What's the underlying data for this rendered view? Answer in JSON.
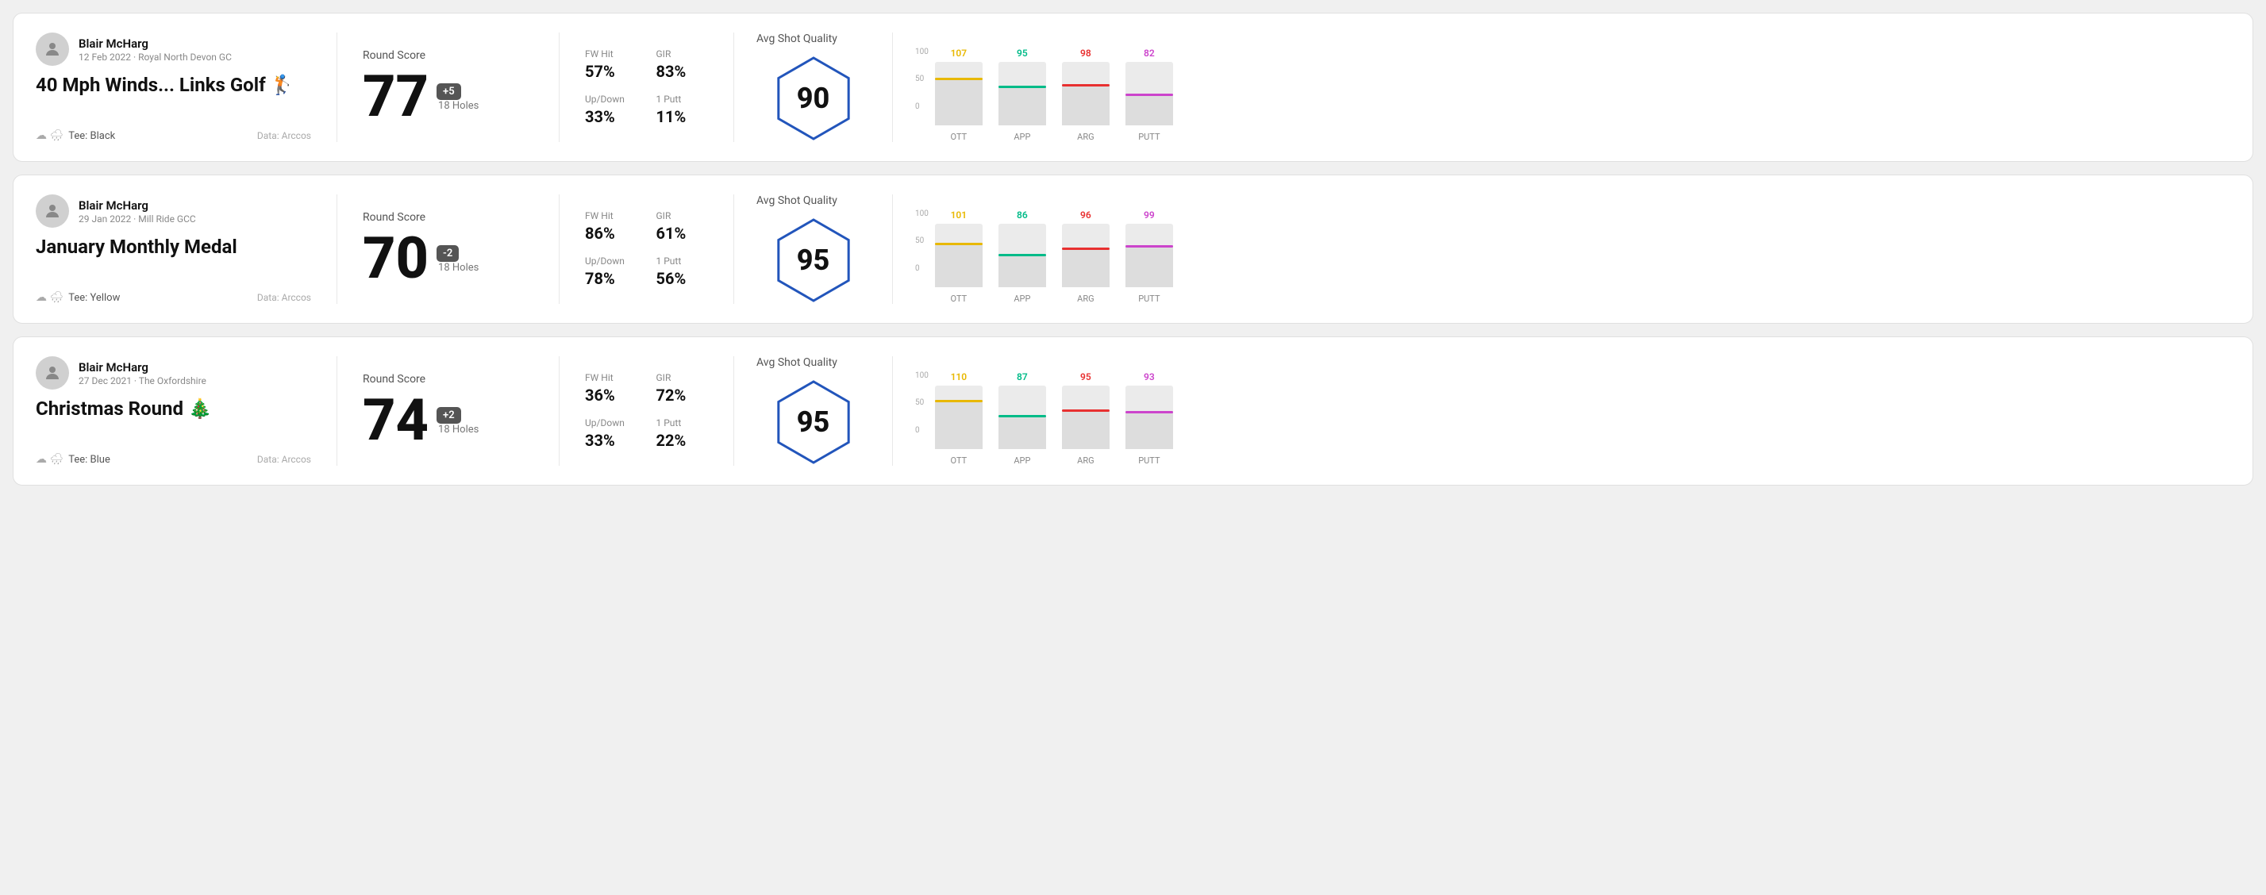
{
  "cards": [
    {
      "id": "card1",
      "player": "Blair McHarg",
      "date": "12 Feb 2022 · Royal North Devon GC",
      "title": "40 Mph Winds... Links Golf 🏌️",
      "tee": "Tee: Black",
      "dataSource": "Data: Arccos",
      "roundScoreLabel": "Round Score",
      "score": "77",
      "scoreBadge": "+5",
      "badgeType": "positive",
      "holes": "18 Holes",
      "stats": [
        {
          "label": "FW Hit",
          "value": "57%"
        },
        {
          "label": "GIR",
          "value": "83%"
        },
        {
          "label": "Up/Down",
          "value": "33%"
        },
        {
          "label": "1 Putt",
          "value": "11%"
        }
      ],
      "qualityLabel": "Avg Shot Quality",
      "qualityScore": "90",
      "bars": [
        {
          "label": "OTT",
          "value": 107,
          "color": "#e8b800",
          "heightPct": 75
        },
        {
          "label": "APP",
          "value": 95,
          "color": "#00bb88",
          "heightPct": 62
        },
        {
          "label": "ARG",
          "value": 98,
          "color": "#e83030",
          "heightPct": 65
        },
        {
          "label": "PUTT",
          "value": 82,
          "color": "#cc44cc",
          "heightPct": 50
        }
      ]
    },
    {
      "id": "card2",
      "player": "Blair McHarg",
      "date": "29 Jan 2022 · Mill Ride GCC",
      "title": "January Monthly Medal",
      "tee": "Tee: Yellow",
      "dataSource": "Data: Arccos",
      "roundScoreLabel": "Round Score",
      "score": "70",
      "scoreBadge": "-2",
      "badgeType": "negative",
      "holes": "18 Holes",
      "stats": [
        {
          "label": "FW Hit",
          "value": "86%"
        },
        {
          "label": "GIR",
          "value": "61%"
        },
        {
          "label": "Up/Down",
          "value": "78%"
        },
        {
          "label": "1 Putt",
          "value": "56%"
        }
      ],
      "qualityLabel": "Avg Shot Quality",
      "qualityScore": "95",
      "bars": [
        {
          "label": "OTT",
          "value": 101,
          "color": "#e8b800",
          "heightPct": 70
        },
        {
          "label": "APP",
          "value": 86,
          "color": "#00bb88",
          "heightPct": 53
        },
        {
          "label": "ARG",
          "value": 96,
          "color": "#e83030",
          "heightPct": 63
        },
        {
          "label": "PUTT",
          "value": 99,
          "color": "#cc44cc",
          "heightPct": 66
        }
      ]
    },
    {
      "id": "card3",
      "player": "Blair McHarg",
      "date": "27 Dec 2021 · The Oxfordshire",
      "title": "Christmas Round 🎄",
      "tee": "Tee: Blue",
      "dataSource": "Data: Arccos",
      "roundScoreLabel": "Round Score",
      "score": "74",
      "scoreBadge": "+2",
      "badgeType": "positive",
      "holes": "18 Holes",
      "stats": [
        {
          "label": "FW Hit",
          "value": "36%"
        },
        {
          "label": "GIR",
          "value": "72%"
        },
        {
          "label": "Up/Down",
          "value": "33%"
        },
        {
          "label": "1 Putt",
          "value": "22%"
        }
      ],
      "qualityLabel": "Avg Shot Quality",
      "qualityScore": "95",
      "bars": [
        {
          "label": "OTT",
          "value": 110,
          "color": "#e8b800",
          "heightPct": 78
        },
        {
          "label": "APP",
          "value": 87,
          "color": "#00bb88",
          "heightPct": 54
        },
        {
          "label": "ARG",
          "value": 95,
          "color": "#e83030",
          "heightPct": 62
        },
        {
          "label": "PUTT",
          "value": 93,
          "color": "#cc44cc",
          "heightPct": 60
        }
      ]
    }
  ]
}
